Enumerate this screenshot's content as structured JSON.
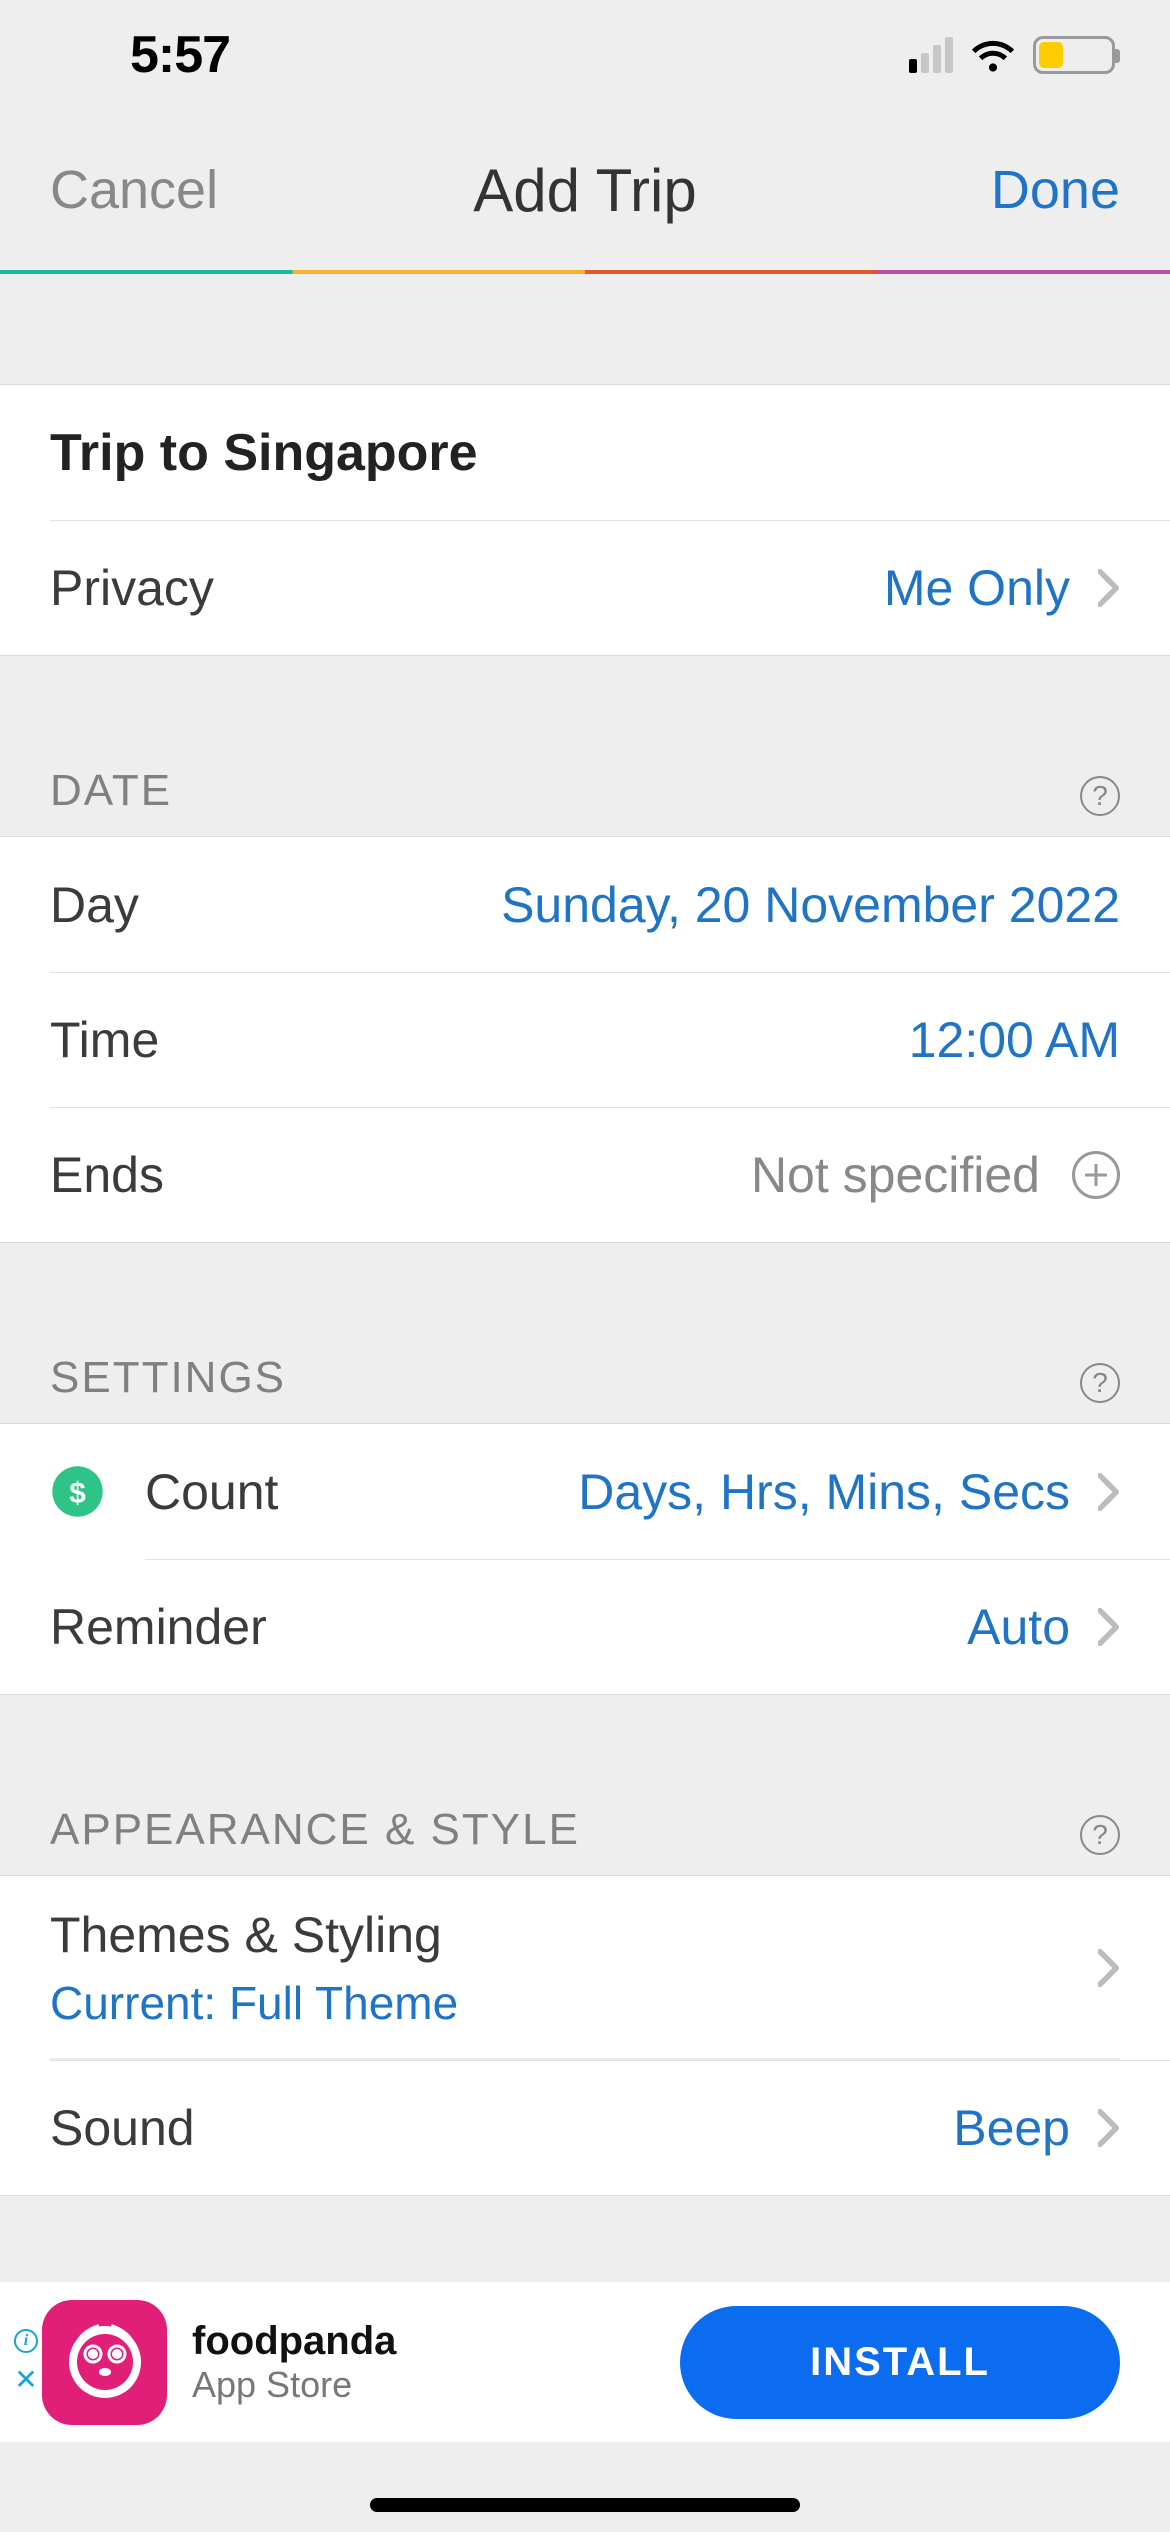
{
  "status": {
    "time": "5:57"
  },
  "nav": {
    "cancel": "Cancel",
    "title": "Add Trip",
    "done": "Done"
  },
  "trip": {
    "name": "Trip to Singapore",
    "privacy_label": "Privacy",
    "privacy_value": "Me Only"
  },
  "sections": {
    "date": "DATE",
    "settings": "SETTINGS",
    "appearance": "APPEARANCE & STYLE"
  },
  "date": {
    "day_label": "Day",
    "day_value": "Sunday, 20 November 2022",
    "time_label": "Time",
    "time_value": "12:00 AM",
    "ends_label": "Ends",
    "ends_value": "Not specified"
  },
  "settings": {
    "count_label": "Count",
    "count_value": "Days, Hrs, Mins, Secs",
    "reminder_label": "Reminder",
    "reminder_value": "Auto"
  },
  "appearance": {
    "themes_label": "Themes & Styling",
    "themes_sub": "Current: Full Theme",
    "sound_label": "Sound",
    "sound_value": "Beep"
  },
  "ad": {
    "app": "foodpanda",
    "store": "App Store",
    "cta": "INSTALL"
  }
}
